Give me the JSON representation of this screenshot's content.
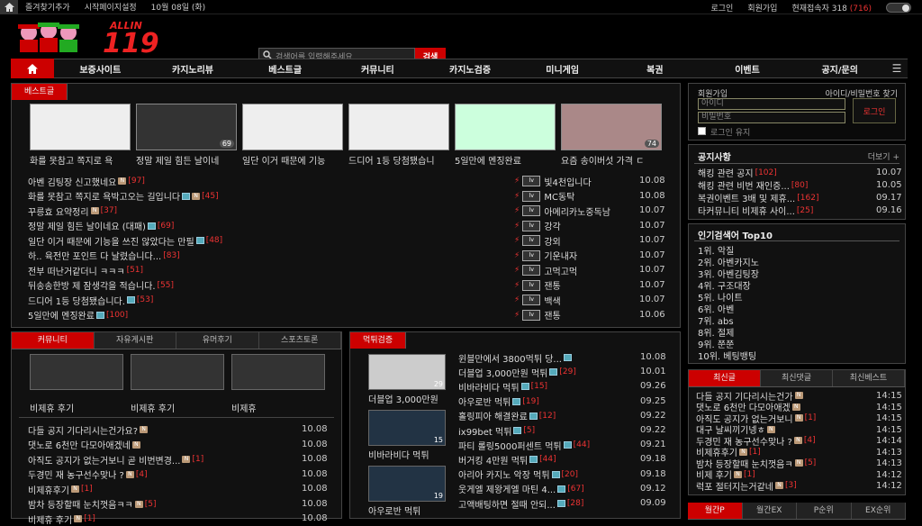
{
  "topbar": {
    "bookmark": "즐겨찾기추가",
    "homepage": "시작페이지설정",
    "date": "10월 08일 (화)",
    "login": "로그인",
    "join": "회원가입",
    "online_label": "현재접속자",
    "online_count": "318",
    "online_extra": "(716)"
  },
  "search": {
    "placeholder": "검색어를 입력해주세요",
    "button": "검색"
  },
  "logo": {
    "text": "ALLIN 119"
  },
  "nav": [
    "보증사이트",
    "카지노리뷰",
    "베스트글",
    "커뮤니티",
    "카지노검증",
    "미니게임",
    "복권",
    "이벤트",
    "공지/문의"
  ],
  "best": {
    "tab": "베스트글",
    "thumbs": [
      {
        "title": "화를 못참고 쪽지로 욕",
        "count": ""
      },
      {
        "title": "정말 제일 힘든 날이네",
        "count": "69"
      },
      {
        "title": "일단 이거 때문에 기능",
        "count": ""
      },
      {
        "title": "드디어 1등 당첨됐습니",
        "count": ""
      },
      {
        "title": "5일만에 멘징완료",
        "count": ""
      },
      {
        "title": "요즘 송이버섯 가격 ㄷ",
        "count": "74"
      }
    ],
    "list": [
      {
        "t": "아벤 김팅장 신고했네요",
        "c": "[97]",
        "b": "b"
      },
      {
        "t": "화를 못참고 쪽지로 욕박고오는 길입니다",
        "c": "[45]",
        "b": "pb"
      },
      {
        "t": "꾸릉효 요약정리",
        "c": "[37]",
        "b": "b"
      },
      {
        "t": "정말 제일 힘든 날이네요 (대패)",
        "c": "[69]",
        "b": "p"
      },
      {
        "t": "일단 이거 때문에 기능을 쓰진 않았다는 만필",
        "c": "[48]",
        "b": "p"
      },
      {
        "t": "하.. 육전만 포인트 다 날렸습니다...",
        "c": "[83]",
        "b": ""
      },
      {
        "t": "전부 떠난거같더니 ㅋㅋㅋ",
        "c": "[51]",
        "b": ""
      },
      {
        "t": "뒤송송한방 제 잠생각을 적습니다.",
        "c": "[55]",
        "b": ""
      },
      {
        "t": "드디어 1등 당첨됐습니다.",
        "c": "[53]",
        "b": "p"
      },
      {
        "t": "5일만에 멘징완료",
        "c": "[100]",
        "b": "p"
      }
    ],
    "right": [
      {
        "t": "빛4천입니다",
        "d": "10.08"
      },
      {
        "t": "MC동탁",
        "d": "10.08"
      },
      {
        "t": "아메리카노중독남",
        "d": "10.07"
      },
      {
        "t": "강각",
        "d": "10.07"
      },
      {
        "t": "강외",
        "d": "10.07"
      },
      {
        "t": "기운내자",
        "d": "10.07"
      },
      {
        "t": "고먹고먹",
        "d": "10.07"
      },
      {
        "t": "잰통",
        "d": "10.07"
      },
      {
        "t": "백색",
        "d": "10.07"
      },
      {
        "t": "잰통",
        "d": "10.06"
      }
    ],
    "dates": [
      "10.08",
      "10.08",
      "10.08",
      "10.07",
      "10.07",
      "10.07",
      "10.07",
      "10.07",
      "10.07",
      "10.06"
    ]
  },
  "community": {
    "tabs": [
      "커뮤니티",
      "자유게시판",
      "유머후기",
      "스포츠토론"
    ],
    "thumbs": [
      {
        "title": "비제휴 후기"
      },
      {
        "title": "비제휴 후기"
      },
      {
        "title": "비제휴"
      }
    ],
    "list": [
      {
        "t": "다들 공지 기다리시는건가요?",
        "c": "",
        "d": "10.08"
      },
      {
        "t": "댓노로 6천만 다모아애겠네",
        "c": "",
        "d": "10.08"
      },
      {
        "t": "아직도 공지가 없는거보니 곧 비번변경...",
        "c": "[1]",
        "d": "10.08"
      },
      {
        "t": "두경민 재 농구선수맞나 ?",
        "c": "[4]",
        "d": "10.08"
      },
      {
        "t": "비제휴후기",
        "c": "[1]",
        "d": "10.08"
      },
      {
        "t": "밤차 등장할때 눈치껏음ㅋㅋ",
        "c": "[5]",
        "d": "10.08"
      },
      {
        "t": "비제휴 후기",
        "c": "[1]",
        "d": "10.08"
      }
    ]
  },
  "verify": {
    "tab": "먹튀검증",
    "thumbs": [
      {
        "title": "더블업 3,000만원",
        "count": "29"
      },
      {
        "title": "비바라비다 먹튀",
        "count": "15"
      },
      {
        "title": "아우로반 먹튀",
        "count": "19"
      }
    ],
    "list": [
      {
        "t": "윈블만에서 3800먹튀 당...",
        "c": "",
        "d": "10.08"
      },
      {
        "t": "더블업 3,000만원 먹튀",
        "c": "[29]",
        "d": "10.01"
      },
      {
        "t": "비바라비다 먹튀",
        "c": "[15]",
        "d": "09.26"
      },
      {
        "t": "아우로반 먹튀",
        "c": "[19]",
        "d": "09.25"
      },
      {
        "t": "홀링피아 해결완료",
        "c": "[12]",
        "d": "09.22"
      },
      {
        "t": "ix99bet 먹튀",
        "c": "[5]",
        "d": "09.22"
      },
      {
        "t": "파티 롤링5000퍼센트 먹튀",
        "c": "[44]",
        "d": "09.21"
      },
      {
        "t": "버거킹 4만원 먹튀",
        "c": "[44]",
        "d": "09.18"
      },
      {
        "t": "아리아 카지노 악장 먹튀",
        "c": "[20]",
        "d": "09.18"
      },
      {
        "t": "웃게엘 제왕게엘 마틴 4...",
        "c": "[67]",
        "d": "09.12"
      },
      {
        "t": "고액배팅하면 절때 안되...",
        "c": "[28]",
        "d": "09.09"
      }
    ]
  },
  "member": {
    "label": "회원가입",
    "find": "아이디/비밀번호 찾기",
    "id_placeholder": "아이디",
    "pw_placeholder": "비밀번호",
    "login": "로그인",
    "keep": "로그인 유지"
  },
  "notice": {
    "title": "공지사항",
    "more": "더보기 +",
    "items": [
      {
        "t": "해킹 관련 공지",
        "c": "[102]",
        "d": "10.07"
      },
      {
        "t": "해킹 관련 비번 재인증...",
        "c": "[80]",
        "d": "10.05"
      },
      {
        "t": "복권이벤트 3배 및 제휴...",
        "c": "[162]",
        "d": "09.17"
      },
      {
        "t": "타커뮤니티 비제휴 사이...",
        "c": "[25]",
        "d": "09.16"
      }
    ]
  },
  "popular": {
    "title": "인기검색어 Top10",
    "items": [
      "1위. 악질",
      "2위. 아벤카지노",
      "3위. 아벤김팅장",
      "4위. 구조대장",
      "5위. 나이트",
      "6위. 아벤",
      "7위. abs",
      "8위. 절제",
      "9위. 쭌쭌",
      "10위. 베팅뱅팅"
    ]
  },
  "recent": {
    "tabs": [
      "최신글",
      "최신댓글",
      "최신베스트"
    ],
    "items": [
      {
        "t": "다들 공지 기다리시는건가",
        "c": "",
        "d": "14:15"
      },
      {
        "t": "댓노로 6천만 다모아애겠",
        "c": "",
        "d": "14:15"
      },
      {
        "t": "아직도 공지가 없는거보니",
        "c": "[1]",
        "d": "14:15"
      },
      {
        "t": "대구 날씨끼기넹ㅎ",
        "c": "",
        "d": "14:15"
      },
      {
        "t": "두경민 재 농구선수맞나 ?",
        "c": "[4]",
        "d": "14:14"
      },
      {
        "t": "비제휴후기",
        "c": "[1]",
        "d": "14:13"
      },
      {
        "t": "밤차 등장할때 눈치껏음ㅋ",
        "c": "[5]",
        "d": "14:13"
      },
      {
        "t": "비제 후기",
        "c": "[1]",
        "d": "14:12"
      },
      {
        "t": "럭포 절터지는거같네",
        "c": "[3]",
        "d": "14:12"
      }
    ]
  },
  "rank": {
    "tabs": [
      "월간P",
      "월간EX",
      "P순위",
      "EX순위"
    ]
  }
}
